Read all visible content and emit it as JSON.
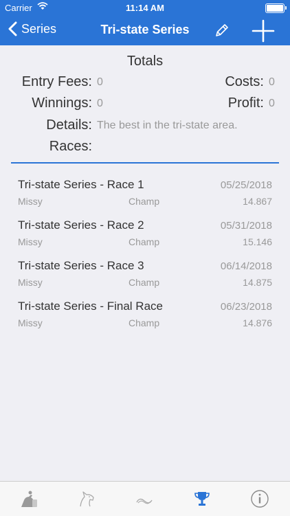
{
  "status_bar": {
    "carrier": "Carrier",
    "time": "11:14 AM"
  },
  "nav": {
    "back_label": "Series",
    "title": "Tri-state Series"
  },
  "totals": {
    "title": "Totals",
    "entry_fees_label": "Entry Fees:",
    "entry_fees_value": "0",
    "costs_label": "Costs:",
    "costs_value": "0",
    "winnings_label": "Winnings:",
    "winnings_value": "0",
    "profit_label": "Profit:",
    "profit_value": "0",
    "details_label": "Details:",
    "details_value": "The best in the tri-state area.",
    "races_label": "Races:"
  },
  "races": [
    {
      "name": "Tri-state Series - Race 1",
      "date": "05/25/2018",
      "horse": "Missy",
      "rider": "Champ",
      "time": "14.867"
    },
    {
      "name": "Tri-state Series - Race 2",
      "date": "05/31/2018",
      "horse": "Missy",
      "rider": "Champ",
      "time": "15.146"
    },
    {
      "name": "Tri-state Series - Race 3",
      "date": "06/14/2018",
      "horse": "Missy",
      "rider": "Champ",
      "time": "14.875"
    },
    {
      "name": "Tri-state Series - Final Race",
      "date": "06/23/2018",
      "horse": "Missy",
      "rider": "Champ",
      "time": "14.876"
    }
  ],
  "tabs": [
    {
      "icon": "barrel-racer-icon",
      "active": false
    },
    {
      "icon": "horse-head-icon",
      "active": false
    },
    {
      "icon": "horseshoe-icon",
      "active": false
    },
    {
      "icon": "trophy-icon",
      "active": true
    },
    {
      "icon": "info-icon",
      "active": false
    }
  ],
  "colors": {
    "accent": "#2a74d6",
    "background": "#efeff4",
    "muted_text": "#999999",
    "tab_inactive": "#aaaaaa"
  }
}
